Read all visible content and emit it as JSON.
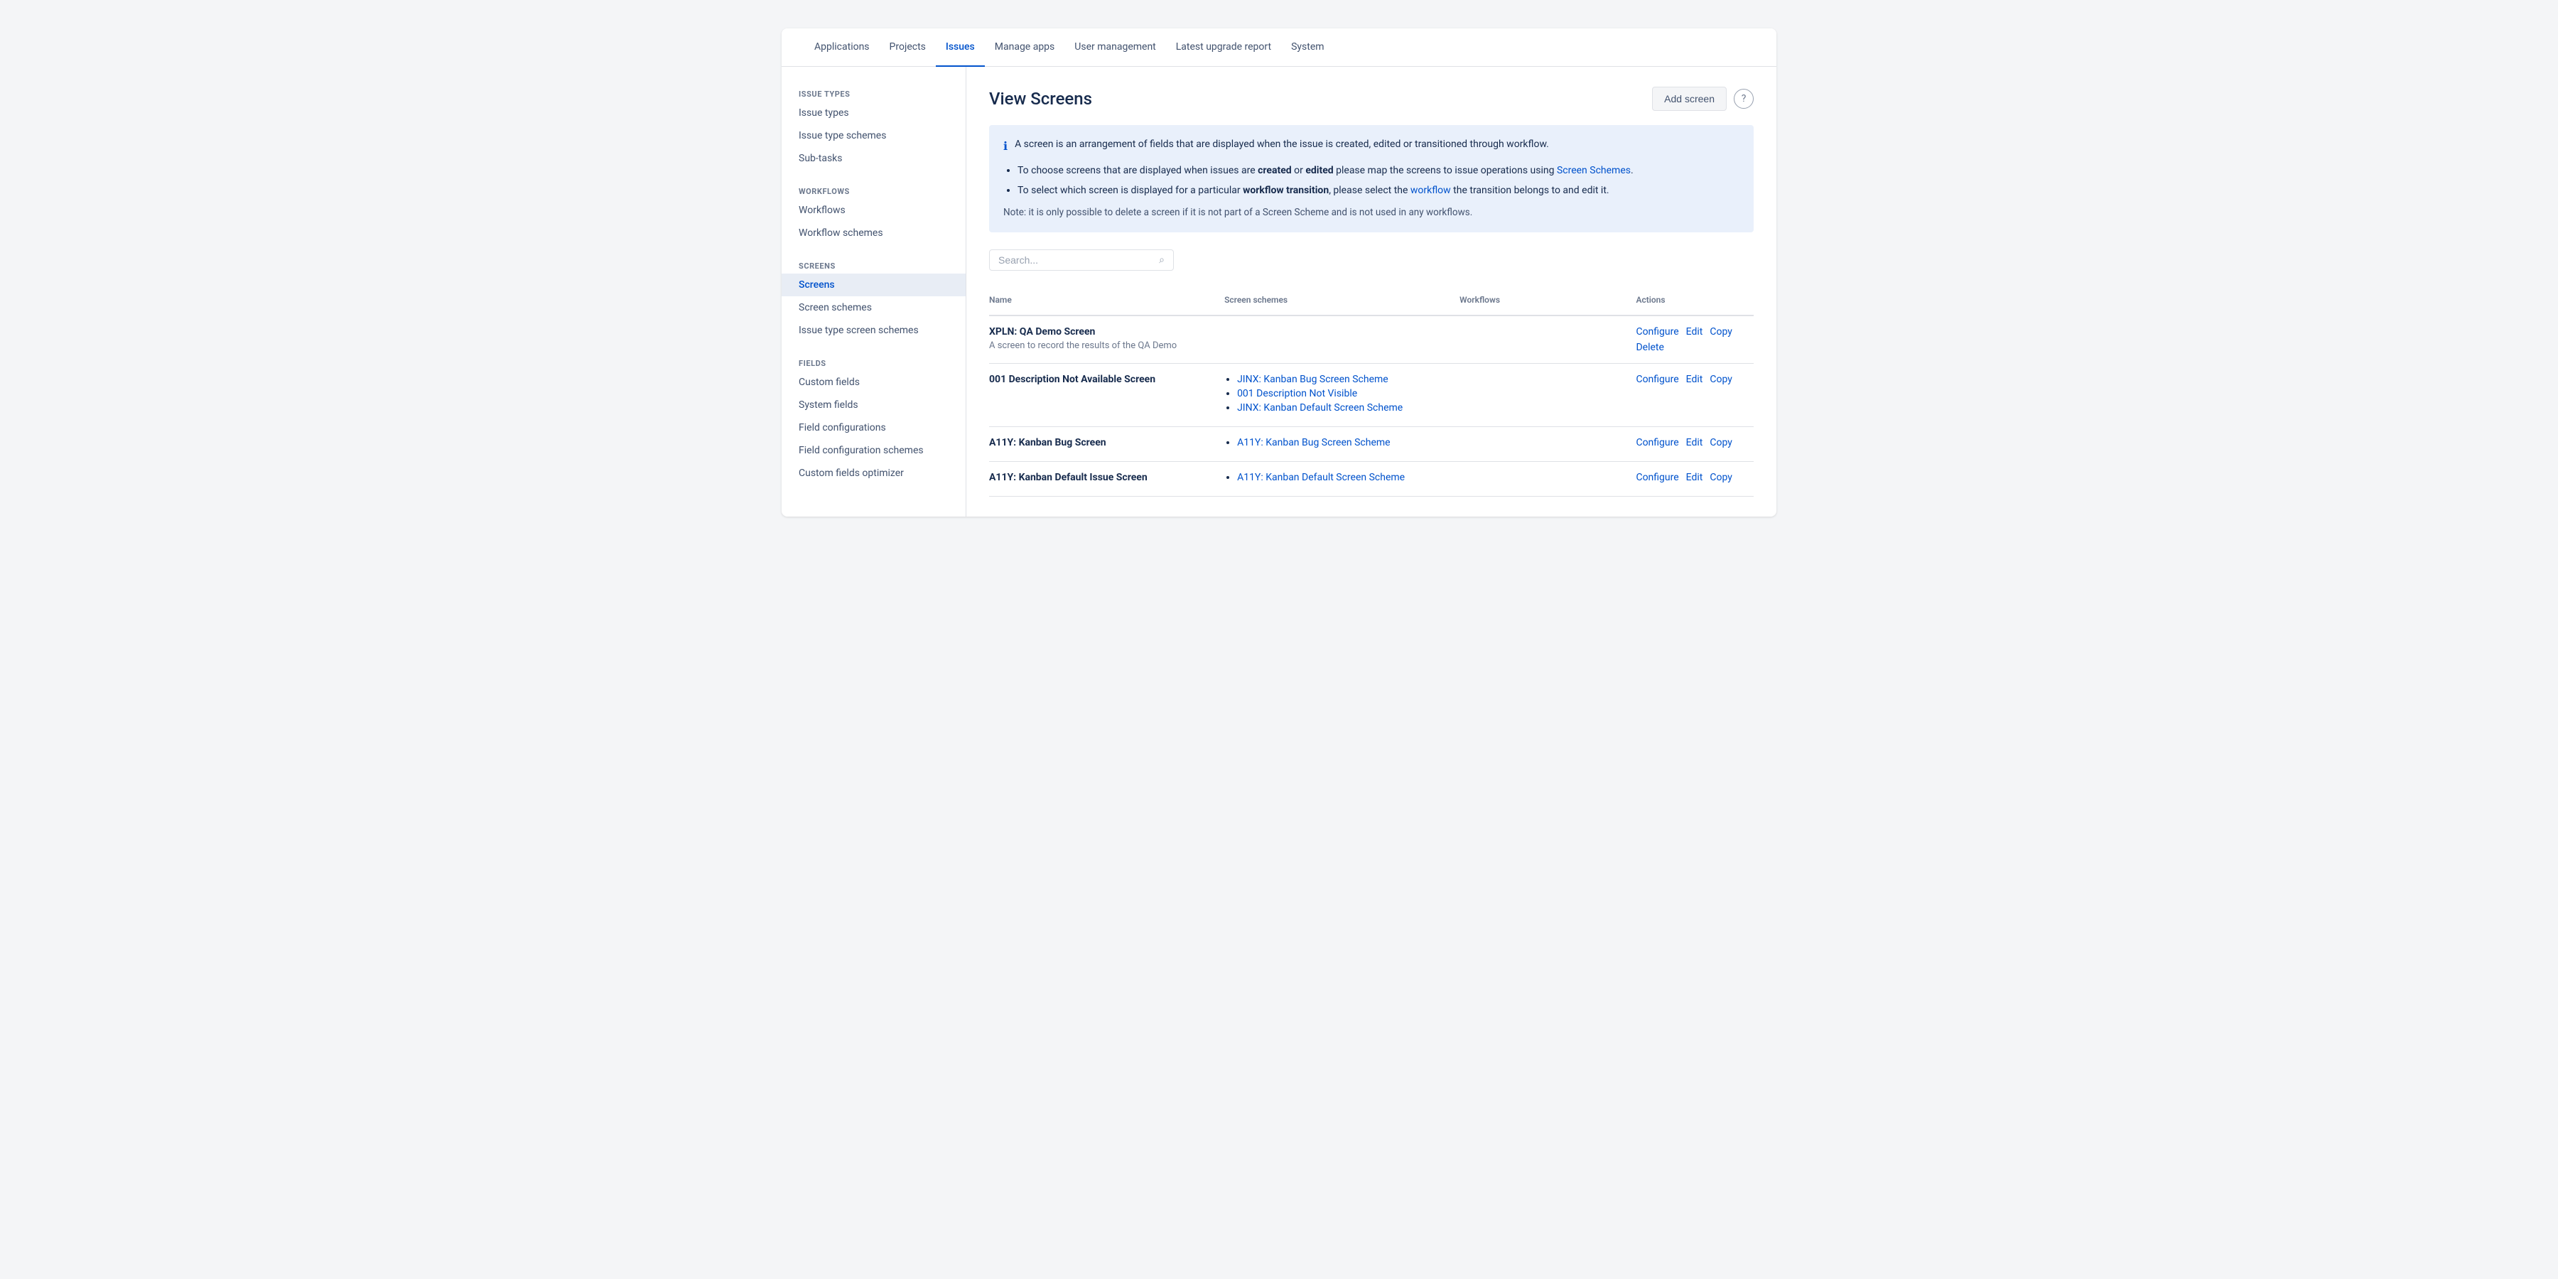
{
  "topNav": {
    "items": [
      {
        "id": "applications",
        "label": "Applications",
        "active": false
      },
      {
        "id": "projects",
        "label": "Projects",
        "active": false
      },
      {
        "id": "issues",
        "label": "Issues",
        "active": true
      },
      {
        "id": "manage-apps",
        "label": "Manage apps",
        "active": false
      },
      {
        "id": "user-management",
        "label": "User management",
        "active": false
      },
      {
        "id": "latest-upgrade-report",
        "label": "Latest upgrade report",
        "active": false
      },
      {
        "id": "system",
        "label": "System",
        "active": false
      }
    ]
  },
  "sidebar": {
    "sections": [
      {
        "id": "issue-types",
        "label": "Issue Types",
        "items": [
          {
            "id": "issue-types",
            "label": "Issue types",
            "active": false
          },
          {
            "id": "issue-type-schemes",
            "label": "Issue type schemes",
            "active": false
          },
          {
            "id": "sub-tasks",
            "label": "Sub-tasks",
            "active": false
          }
        ]
      },
      {
        "id": "workflows",
        "label": "Workflows",
        "items": [
          {
            "id": "workflows",
            "label": "Workflows",
            "active": false
          },
          {
            "id": "workflow-schemes",
            "label": "Workflow schemes",
            "active": false
          }
        ]
      },
      {
        "id": "screens",
        "label": "Screens",
        "items": [
          {
            "id": "screens",
            "label": "Screens",
            "active": true
          },
          {
            "id": "screen-schemes",
            "label": "Screen schemes",
            "active": false
          },
          {
            "id": "issue-type-screen-schemes",
            "label": "Issue type screen schemes",
            "active": false
          }
        ]
      },
      {
        "id": "fields",
        "label": "Fields",
        "items": [
          {
            "id": "custom-fields",
            "label": "Custom fields",
            "active": false
          },
          {
            "id": "system-fields",
            "label": "System fields",
            "active": false
          },
          {
            "id": "field-configurations",
            "label": "Field configurations",
            "active": false
          },
          {
            "id": "field-configuration-schemes",
            "label": "Field configuration schemes",
            "active": false
          },
          {
            "id": "custom-fields-optimizer",
            "label": "Custom fields optimizer",
            "active": false
          }
        ]
      }
    ]
  },
  "page": {
    "title": "View Screens",
    "addScreenButton": "Add screen",
    "infoBox": {
      "mainText": "A screen is an arrangement of fields that are displayed when the issue is created, edited or transitioned through workflow.",
      "bullets": [
        {
          "id": "bullet1",
          "text_before": "To choose screens that are displayed when issues are ",
          "bold1": "created",
          "text_middle": " or ",
          "bold2": "edited",
          "text_after": " please map the screens to issue operations using ",
          "link_text": "Screen Schemes",
          "link_href": "#",
          "end": "."
        },
        {
          "id": "bullet2",
          "text_before": "To select which screen is displayed for a particular ",
          "bold": "workflow transition",
          "text_middle": ", please select the ",
          "link_text": "workflow",
          "link_href": "#",
          "text_after": " the transition belongs to and edit it."
        }
      ],
      "noteText": "Note: it is only possible to delete a screen if it is not part of a Screen Scheme and is not used in any workflows."
    },
    "search": {
      "placeholder": "Search..."
    },
    "table": {
      "headers": [
        {
          "id": "name",
          "label": "Name"
        },
        {
          "id": "screen-schemes",
          "label": "Screen schemes"
        },
        {
          "id": "workflows",
          "label": "Workflows"
        },
        {
          "id": "actions",
          "label": "Actions"
        }
      ],
      "rows": [
        {
          "id": "row1",
          "name": "XPLN: QA Demo Screen",
          "description": "A screen to record the results of the QA Demo",
          "screenSchemes": [],
          "workflows": [],
          "actions": [
            {
              "id": "configure",
              "label": "Configure"
            },
            {
              "id": "edit",
              "label": "Edit"
            },
            {
              "id": "copy",
              "label": "Copy"
            },
            {
              "id": "delete",
              "label": "Delete"
            }
          ]
        },
        {
          "id": "row2",
          "name": "001 Description Not Available Screen",
          "description": "",
          "screenSchemes": [
            {
              "id": "ss1",
              "label": "JINX: Kanban Bug Screen Scheme"
            },
            {
              "id": "ss2",
              "label": "001 Description Not Visible"
            },
            {
              "id": "ss3",
              "label": "JINX: Kanban Default Screen Scheme"
            }
          ],
          "workflows": [],
          "actions": [
            {
              "id": "configure",
              "label": "Configure"
            },
            {
              "id": "edit",
              "label": "Edit"
            },
            {
              "id": "copy",
              "label": "Copy"
            }
          ]
        },
        {
          "id": "row3",
          "name": "A11Y: Kanban Bug Screen",
          "description": "",
          "screenSchemes": [
            {
              "id": "ss1",
              "label": "A11Y: Kanban Bug Screen Scheme"
            }
          ],
          "workflows": [],
          "actions": [
            {
              "id": "configure",
              "label": "Configure"
            },
            {
              "id": "edit",
              "label": "Edit"
            },
            {
              "id": "copy",
              "label": "Copy"
            }
          ]
        },
        {
          "id": "row4",
          "name": "A11Y: Kanban Default Issue Screen",
          "description": "",
          "screenSchemes": [
            {
              "id": "ss1",
              "label": "A11Y: Kanban Default Screen Scheme"
            }
          ],
          "workflows": [],
          "actions": [
            {
              "id": "configure",
              "label": "Configure"
            },
            {
              "id": "edit",
              "label": "Edit"
            },
            {
              "id": "copy",
              "label": "Copy"
            }
          ]
        }
      ]
    }
  },
  "colors": {
    "accent": "#0052cc",
    "activeNav": "#0052cc",
    "text": "#172b4d",
    "muted": "#6b778c",
    "border": "#dfe1e6",
    "infoBg": "#e9f0fb"
  }
}
